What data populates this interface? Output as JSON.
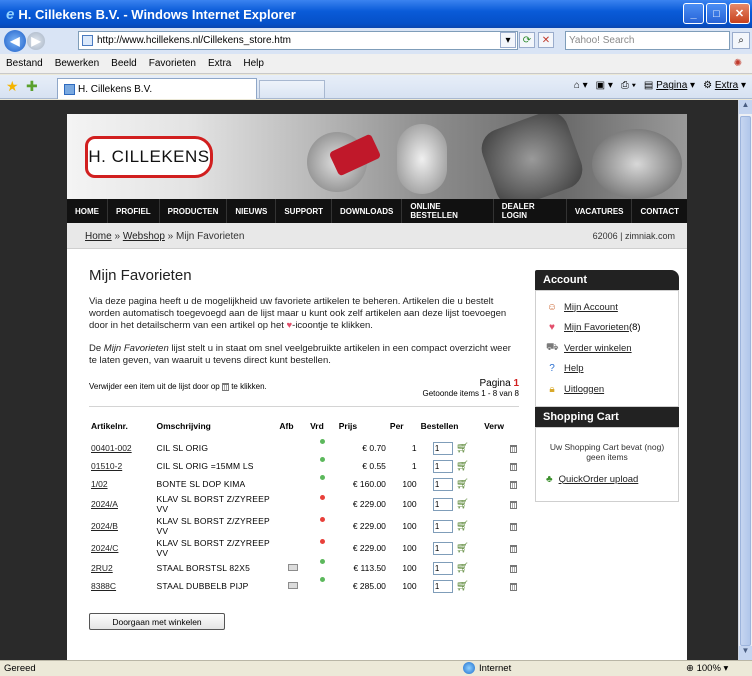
{
  "browser": {
    "title": "H. Cillekens B.V. - Windows Internet Explorer",
    "url": "http://www.hcillekens.nl/Cillekens_store.htm",
    "search_placeholder": "Yahoo! Search",
    "menu": [
      "Bestand",
      "Bewerken",
      "Beeld",
      "Favorieten",
      "Extra",
      "Help"
    ],
    "tab_label": "H. Cillekens B.V.",
    "cmd_pagina": "Pagina",
    "cmd_extra": "Extra",
    "status_text": "Gereed",
    "zone_text": "Internet",
    "zoom_text": "100%"
  },
  "site": {
    "logo_text": "H. CILLEKENS",
    "nav": [
      "HOME",
      "PROFIEL",
      "PRODUCTEN",
      "NIEUWS",
      "SUPPORT",
      "DOWNLOADS",
      "ONLINE BESTELLEN",
      "DEALER LOGIN",
      "VACATURES",
      "CONTACT"
    ],
    "breadcrumb": {
      "home": "Home",
      "sep": "»",
      "webshop": "Webshop",
      "current": "Mijn Favorieten"
    },
    "breadcrumb_right": "62006 | zimniak.com"
  },
  "main": {
    "heading": "Mijn Favorieten",
    "intro_before_icon": "Via deze pagina heeft u de mogelijkheid uw favoriete artikelen te beheren. Artikelen die u bestelt worden automatisch toegevoegd aan de lijst maar u kunt ook zelf artikelen aan deze lijst toevoegen door in het detailscherm van een artikel op het ",
    "intro_after_icon": "-icoontje te klikken.",
    "p2_before": "De ",
    "p2_em": "Mijn Favorieten",
    "p2_after": " lijst stelt u in staat om snel veelgebruikte artikelen in een compact overzicht weer te laten geven, van waaruit u tevens direct kunt bestellen.",
    "remove_hint_before": "Verwijder een item uit de lijst door op ",
    "remove_hint_after": " te klikken.",
    "pagina_label": "Pagina",
    "pagina_num": "1",
    "shown_items": "Getoonde items 1 - 8 van 8",
    "columns": [
      "Artikelnr.",
      "Omschrijving",
      "Afb",
      "Vrd",
      "Prijs",
      "Per",
      "Bestellen",
      "Verw"
    ],
    "rows": [
      {
        "code": "00401-002",
        "desc": "CIL SL ORIG",
        "img": false,
        "stock": "green",
        "price": "€ 0.70",
        "per": "1",
        "qty": "1"
      },
      {
        "code": "01510-2",
        "desc": "CIL SL ORIG =15MM LS",
        "img": false,
        "stock": "green",
        "price": "€ 0.55",
        "per": "1",
        "qty": "1"
      },
      {
        "code": "1/02",
        "desc": "BONTE SL DOP KIMA",
        "img": false,
        "stock": "green",
        "price": "€ 160.00",
        "per": "100",
        "qty": "1"
      },
      {
        "code": "2024/A",
        "desc": "KLAV SL BORST Z/ZYREEP VV",
        "img": false,
        "stock": "red",
        "price": "€ 229.00",
        "per": "100",
        "qty": "1"
      },
      {
        "code": "2024/B",
        "desc": "KLAV SL BORST Z/ZYREEP VV",
        "img": false,
        "stock": "red",
        "price": "€ 229.00",
        "per": "100",
        "qty": "1"
      },
      {
        "code": "2024/C",
        "desc": "KLAV SL BORST Z/ZYREEP VV",
        "img": false,
        "stock": "red",
        "price": "€ 229.00",
        "per": "100",
        "qty": "1"
      },
      {
        "code": "2RU2",
        "desc": "STAAL BORSTSL 82X5",
        "img": true,
        "stock": "green",
        "price": "€ 113.50",
        "per": "100",
        "qty": "1"
      },
      {
        "code": "8388C",
        "desc": "STAAL DUBBELB PIJP",
        "img": true,
        "stock": "green",
        "price": "€ 285.00",
        "per": "100",
        "qty": "1"
      }
    ],
    "continue_button": "Doorgaan met winkelen"
  },
  "sidebar": {
    "account_title": "Account",
    "account_items": [
      {
        "label": "Mijn Account",
        "suffix": "",
        "icon": "user-icon"
      },
      {
        "label": "Mijn Favorieten",
        "suffix": " (8)",
        "icon": "heart-icon"
      },
      {
        "label": "Verder winkelen",
        "suffix": "",
        "icon": "cart-icon"
      },
      {
        "label": "Help",
        "suffix": "",
        "icon": "help-icon"
      },
      {
        "label": "Uitloggen",
        "suffix": "",
        "icon": "lock-icon"
      }
    ],
    "cart_title": "Shopping Cart",
    "cart_text": "Uw Shopping Cart bevat (nog) geen items",
    "quickorder": "QuickOrder upload"
  },
  "colors": {
    "stock_green": "#5cb85c",
    "stock_red": "#e8403a",
    "accent_red": "#d11f1f"
  }
}
